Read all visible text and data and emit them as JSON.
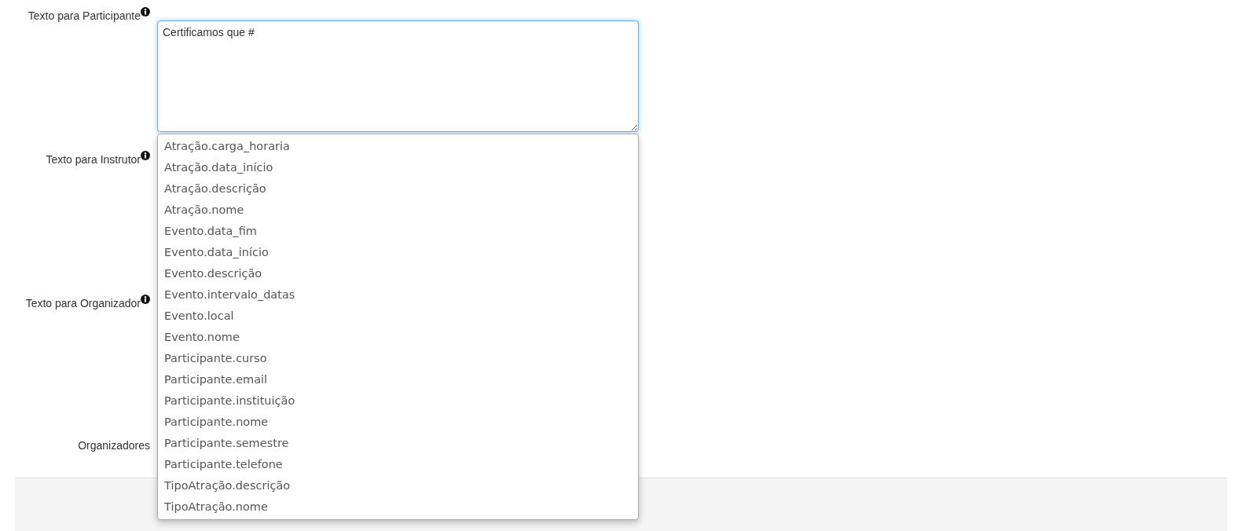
{
  "fields": [
    {
      "label": "Texto para Participante",
      "info": true,
      "value": "Certificamos que #"
    },
    {
      "label": "Texto para Instrutor",
      "info": true
    },
    {
      "label": "Texto para Organizador",
      "info": true
    },
    {
      "label": "Organizadores",
      "info": false
    }
  ],
  "suggestions": [
    "Atração.carga_horaria",
    "Atração.data_início",
    "Atração.descrição",
    "Atração.nome",
    "Evento.data_fim",
    "Evento.data_início",
    "Evento.descrição",
    "Evento.intervalo_datas",
    "Evento.local",
    "Evento.nome",
    "Participante.curso",
    "Participante.email",
    "Participante.instituição",
    "Participante.nome",
    "Participante.semestre",
    "Participante.telefone",
    "TipoAtração.descrição",
    "TipoAtração.nome"
  ]
}
